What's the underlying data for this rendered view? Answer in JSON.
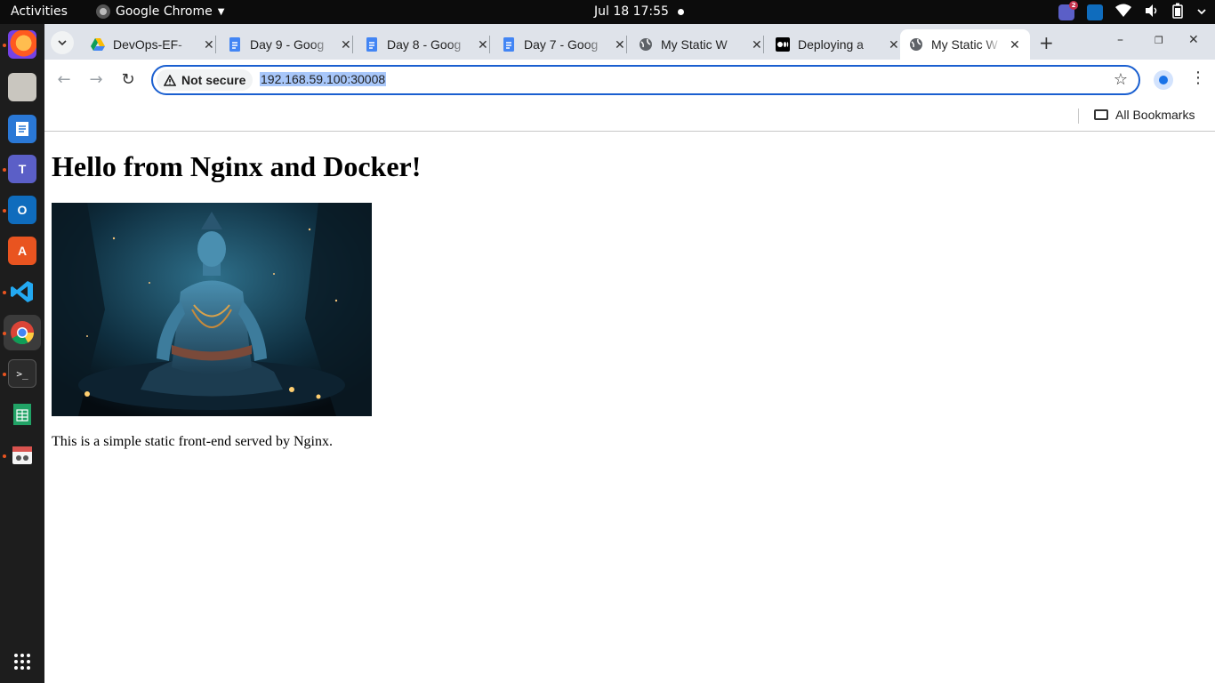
{
  "topbar": {
    "activities": "Activities",
    "app_name": "Google Chrome",
    "clock": "Jul 18  17:55",
    "teams_badge": "2"
  },
  "dock": {
    "items": [
      "firefox",
      "files",
      "text-editor",
      "teams",
      "outlook",
      "software",
      "vscode",
      "chrome",
      "terminal",
      "spreadsheet",
      "screenshot"
    ]
  },
  "chrome": {
    "tabs": [
      {
        "title": "DevOps-EF-",
        "icon": "google-drive-icon"
      },
      {
        "title": "Day 9 - Goog",
        "icon": "google-docs-icon"
      },
      {
        "title": "Day 8 - Goog",
        "icon": "google-docs-icon"
      },
      {
        "title": "Day 7 - Goog",
        "icon": "google-docs-icon"
      },
      {
        "title": "My Static W",
        "icon": "globe-icon"
      },
      {
        "title": "Deploying a",
        "icon": "medium-icon"
      },
      {
        "title": "My Static W",
        "icon": "globe-icon",
        "active": true
      }
    ],
    "security_label": "Not secure",
    "url": "192.168.59.100:30008",
    "all_bookmarks": "All Bookmarks"
  },
  "page": {
    "heading": "Hello from Nginx and Docker!",
    "paragraph": "This is a simple static front-end served by Nginx."
  },
  "colors": {
    "tabstrip_bg": "#dfe3ea",
    "omnibox_border": "#1a5fd0",
    "url_selection": "#a8c7fa",
    "ubuntu_orange": "#e95420"
  }
}
